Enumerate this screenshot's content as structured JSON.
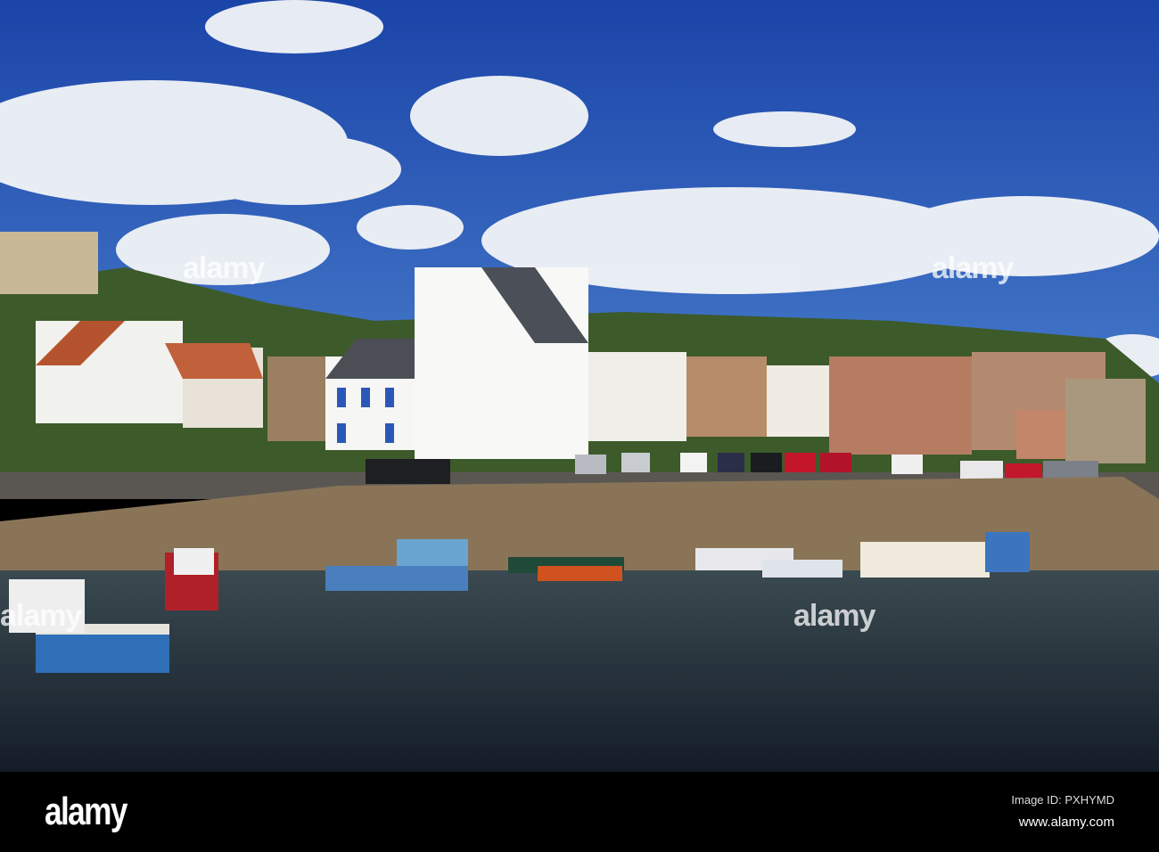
{
  "watermark": "alamy",
  "footer": {
    "logo": "alamy",
    "image_id": "Image ID: PXHYMD",
    "url": "www.alamy.com"
  },
  "colors": {
    "sky": "#1f4fae",
    "water": "#1e2d3c",
    "wall": "#8a7458"
  }
}
